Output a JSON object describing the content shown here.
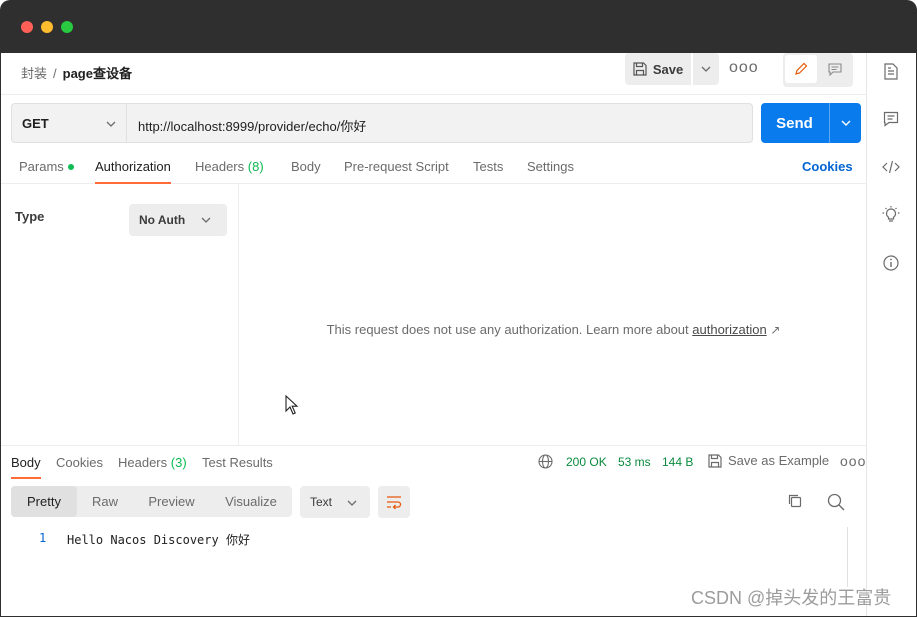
{
  "window": {
    "traffic_lights": [
      "close",
      "minimize",
      "zoom"
    ]
  },
  "breadcrumb": {
    "parent": "封装",
    "separator": "/",
    "current": "page查设备"
  },
  "toolbar": {
    "save_label": "Save",
    "more_label": "ooo"
  },
  "request": {
    "method": "GET",
    "url": "http://localhost:8999/provider/echo/你好",
    "send_label": "Send"
  },
  "request_tabs": [
    {
      "label": "Params",
      "dot": true
    },
    {
      "label": "Authorization",
      "active": true
    },
    {
      "label": "Headers",
      "count": "(8)"
    },
    {
      "label": "Body"
    },
    {
      "label": "Pre-request Script"
    },
    {
      "label": "Tests"
    },
    {
      "label": "Settings"
    }
  ],
  "cookies_label": "Cookies",
  "auth": {
    "type_label": "Type",
    "type_value": "No Auth",
    "message": "This request does not use any authorization. Learn more about ",
    "link": "authorization",
    "link_arrow": "↗"
  },
  "response_tabs": [
    {
      "label": "Body",
      "active": true
    },
    {
      "label": "Cookies"
    },
    {
      "label": "Headers",
      "count": "(3)"
    },
    {
      "label": "Test Results"
    }
  ],
  "response_meta": {
    "status": "200 OK",
    "time": "53 ms",
    "size": "144 B",
    "save_example": "Save as Example",
    "more_label": "ooo"
  },
  "view_modes": [
    "Pretty",
    "Raw",
    "Preview",
    "Visualize"
  ],
  "active_view_mode": "Pretty",
  "format": "Text",
  "response_body": [
    {
      "line": "1",
      "text": "Hello Nacos Discovery 你好"
    }
  ],
  "watermark": "CSDN @掉头发的王富贵",
  "colors": {
    "accent_orange": "#ff6c37",
    "send_blue": "#097bed",
    "status_green": "#0a8a3e",
    "link_blue": "#0265d2"
  },
  "icons": {
    "right_sidebar": [
      "document-icon",
      "comment-icon",
      "code-icon",
      "lightbulb-icon",
      "info-icon"
    ]
  }
}
